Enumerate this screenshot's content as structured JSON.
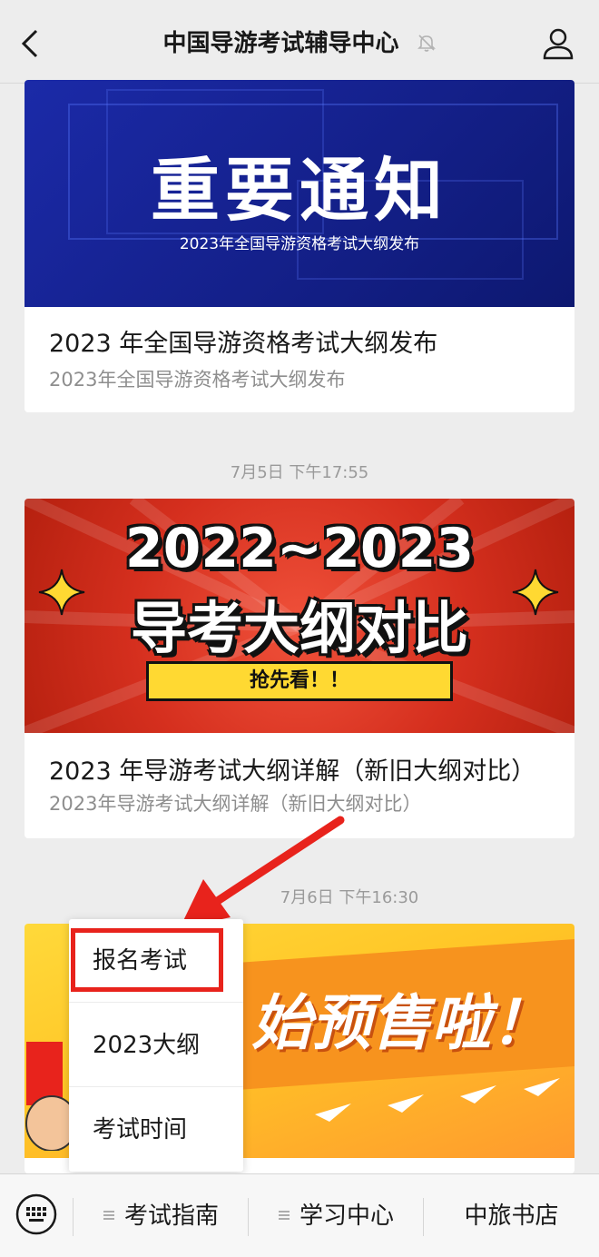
{
  "header": {
    "title": "中国导游考试辅导中心"
  },
  "articles": [
    {
      "banner_title": "重要通知",
      "banner_subtitle": "2023年全国导游资格考试大纲发布",
      "title": "2023 年全国导游资格考试大纲发布",
      "summary": "2023年全国导游资格考试大纲发布"
    },
    {
      "timestamp": "7月5日 下午17:55",
      "banner_line1": "2022~2023",
      "banner_line2": "导考大纲对比",
      "banner_tag": "抢先看！！",
      "title": "2023 年导游考试大纲详解（新旧大纲对比）",
      "summary": "2023年导游考试大纲详解（新旧大纲对比）"
    },
    {
      "timestamp": "7月6日 下午16:30",
      "banner_slogan": "始预售啦！"
    }
  ],
  "popup_menu": {
    "items": [
      "报名考试",
      "2023大纲",
      "考试时间"
    ],
    "highlighted_index": 0
  },
  "bottom_bar": {
    "tabs": [
      "考试指南",
      "学习中心",
      "中旅书店"
    ]
  },
  "colors": {
    "highlight_red": "#e8231c",
    "page_bg": "#ededed"
  }
}
